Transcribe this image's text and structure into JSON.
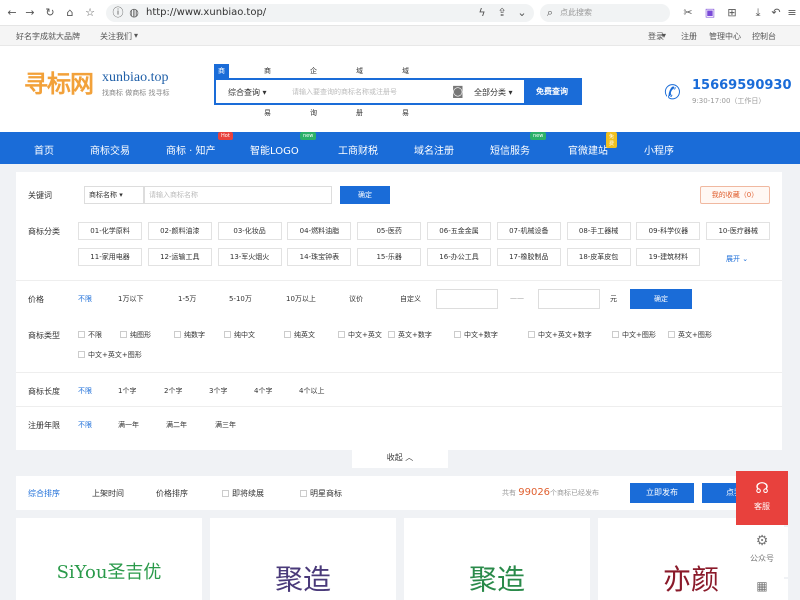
{
  "browser": {
    "url": "http://www.xunbiao.top/",
    "search_placeholder": "点此搜索"
  },
  "toplinks": {
    "left1": "好名字成就大品牌",
    "left2": "关注我们",
    "right": [
      "登录",
      "注册",
      "管理中心",
      "控制台"
    ]
  },
  "header": {
    "logo_cn": "寻标网",
    "logo_en": "xunbiao.top",
    "logo_sub": "找商标 做商标 找寻标",
    "search_tabs": [
      "商标注册",
      "商标交易",
      "企业查询",
      "域名注册",
      "域名交易"
    ],
    "search_select": "综合查询",
    "search_placeholder": "请输入要查询的商标名称或注册号",
    "search_category": "全部分类",
    "search_button": "免费查询",
    "phone": "15669590930",
    "hours": "9:30-17:00（工作日）"
  },
  "nav": {
    "items": [
      {
        "label": "首页",
        "badge": ""
      },
      {
        "label": "商标交易",
        "badge": ""
      },
      {
        "label": "商标 · 知产",
        "badge": "Hot"
      },
      {
        "label": "智能LOGO",
        "badge": "new"
      },
      {
        "label": "工商财税",
        "badge": ""
      },
      {
        "label": "域名注册",
        "badge": ""
      },
      {
        "label": "短信服务",
        "badge": "new"
      },
      {
        "label": "官微建站",
        "badge": "免费"
      },
      {
        "label": "小程序",
        "badge": ""
      }
    ]
  },
  "filter": {
    "keyword_label": "关键词",
    "keyword_select": "商标名称",
    "keyword_placeholder": "请输入商标名称",
    "keyword_button": "确定",
    "favorites": "我的收藏（0）",
    "class_label": "商标分类",
    "classes": [
      "01-化学原料",
      "02-颜料油漆",
      "03-化妆品",
      "04-燃料油脂",
      "05-医药",
      "06-五金金属",
      "07-机械设备",
      "08-手工器械",
      "09-科学仪器",
      "10-医疗器械",
      "11-家用电器",
      "12-运输工具",
      "13-军火烟火",
      "14-珠宝钟表",
      "15-乐器",
      "16-办公工具",
      "17-橡胶制品",
      "18-皮革皮包",
      "19-建筑材料"
    ],
    "class_more": "展开",
    "price_label": "价格",
    "prices": [
      "不限",
      "1万以下",
      "1-5万",
      "5-10万",
      "10万以上",
      "议价"
    ],
    "price_custom": "自定义",
    "price_dash": "——",
    "price_unit": "元",
    "price_button": "确定",
    "type_label": "商标类型",
    "types": [
      "不限",
      "纯图形",
      "纯数字",
      "纯中文",
      "纯英文",
      "中文+英文",
      "英文+数字",
      "中文+数字",
      "中文+英文+数字",
      "中文+图形",
      "英文+图形",
      "中文+英文+图形"
    ],
    "length_label": "商标长度",
    "lengths": [
      "不限",
      "1个字",
      "2个字",
      "3个字",
      "4个字",
      "4个以上"
    ],
    "year_label": "注册年限",
    "years": [
      "不限",
      "满一年",
      "满二年",
      "满三年"
    ],
    "collapse": "收起"
  },
  "sortbar": {
    "options": [
      "综合排序",
      "上架时间",
      "价格排序"
    ],
    "checks": [
      "即将续展",
      "明星商标"
    ],
    "total_prefix": "共有",
    "total_count": "99026",
    "total_suffix": "个商标已经发布",
    "publish_button": "立即发布",
    "other_button": "点我"
  },
  "cards": [
    {
      "logo": "SiYou圣吉优",
      "color": "#2a9a4a"
    },
    {
      "logo": "聚造",
      "color": "#4a3a7a"
    },
    {
      "logo": "聚造",
      "color": "#2a8a4a"
    },
    {
      "logo": "亦颜",
      "color": "#8a1a2a"
    }
  ],
  "float": {
    "service": "客服",
    "official": "公众号"
  }
}
